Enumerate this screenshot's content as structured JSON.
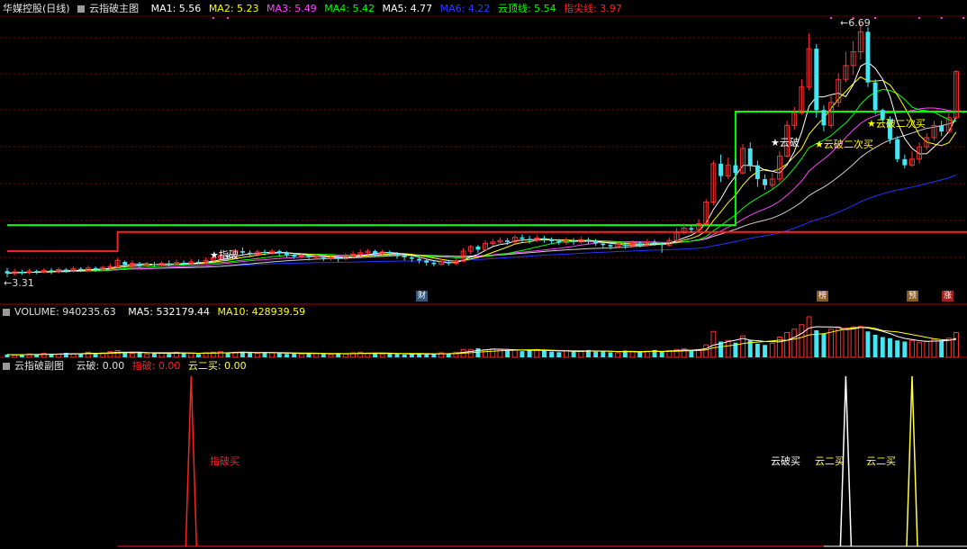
{
  "colors": {
    "ma1": "#ffffff",
    "ma2": "#ffff00",
    "ma3": "#ff44ff",
    "ma4": "#00ff00",
    "ma5": "#ffffff",
    "ma6": "#2233ff",
    "cloud": "#00ff00",
    "indicator": "#ff2020",
    "up": "#ff3030",
    "down": "#45e5f2",
    "grid": "#800000",
    "sub_red": "#ff2020",
    "sub_white": "#ffffff",
    "sub_yellow": "#ffff40"
  },
  "main_header": {
    "stock": "华媒控股(日线)",
    "indicator": "云指破主图",
    "ma1": "MA1: 5.56",
    "ma2": "MA2: 5.23",
    "ma3": "MA3: 5.49",
    "ma4": "MA4: 5.42",
    "ma5": "MA5: 4.77",
    "ma6": "MA6: 4.22",
    "cloud_line": "云顶线: 5.54",
    "indicator_line": "指尖线: 3.97"
  },
  "price_labels": {
    "high": "6.69",
    "low": "3.31"
  },
  "signals": {
    "zhipo": "指破",
    "yunpo": "云破",
    "yunpo_second": "云破二次买",
    "yunpo_second_2": "云破二次买"
  },
  "badges": {
    "cai": "财",
    "bang": "榜",
    "yu": "预",
    "zhang": "涨"
  },
  "volume_header": {
    "volume": "VOLUME: 940235.63",
    "ma5": "MA5: 532179.44",
    "ma10": "MA10: 428939.59"
  },
  "sub_header": {
    "name": "云指破副图",
    "yunpo": "云破: 0.00",
    "zhipo": "指破: 0.00",
    "yun_er": "云二买: 0.00"
  },
  "sub_labels": {
    "zhipo_buy": "指破买",
    "yunpo_buy": "云破买",
    "yun_er_buy_1": "云二买",
    "yun_er_buy_2": "云二买"
  },
  "chart_data": {
    "type": "candlestick",
    "title": "华媒控股(日线)",
    "price_range": [
      3.31,
      6.69
    ],
    "cloud_top_line": 5.54,
    "indicator_line": 3.97,
    "candles": [
      [
        3.46,
        3.43,
        3.5,
        3.38
      ],
      [
        3.43,
        3.45,
        3.49,
        3.4
      ],
      [
        3.45,
        3.44,
        3.48,
        3.41
      ],
      [
        3.44,
        3.46,
        3.49,
        3.42
      ],
      [
        3.46,
        3.45,
        3.48,
        3.42
      ],
      [
        3.45,
        3.47,
        3.5,
        3.43
      ],
      [
        3.47,
        3.45,
        3.5,
        3.42
      ],
      [
        3.45,
        3.48,
        3.51,
        3.43
      ],
      [
        3.48,
        3.46,
        3.5,
        3.44
      ],
      [
        3.46,
        3.49,
        3.52,
        3.44
      ],
      [
        3.49,
        3.47,
        3.51,
        3.45
      ],
      [
        3.47,
        3.5,
        3.53,
        3.45
      ],
      [
        3.5,
        3.48,
        3.52,
        3.45
      ],
      [
        3.48,
        3.51,
        3.53,
        3.46
      ],
      [
        3.51,
        3.52,
        3.56,
        3.48
      ],
      [
        3.52,
        3.6,
        3.63,
        3.5
      ],
      [
        3.58,
        3.54,
        3.6,
        3.5
      ],
      [
        3.54,
        3.56,
        3.6,
        3.5
      ],
      [
        3.56,
        3.53,
        3.58,
        3.5
      ],
      [
        3.53,
        3.55,
        3.58,
        3.5
      ],
      [
        3.55,
        3.54,
        3.58,
        3.51
      ],
      [
        3.54,
        3.56,
        3.59,
        3.52
      ],
      [
        3.56,
        3.55,
        3.6,
        3.52
      ],
      [
        3.55,
        3.57,
        3.61,
        3.53
      ],
      [
        3.57,
        3.56,
        3.6,
        3.53
      ],
      [
        3.56,
        3.58,
        3.62,
        3.54
      ],
      [
        3.58,
        3.57,
        3.61,
        3.55
      ],
      [
        3.57,
        3.6,
        3.64,
        3.55
      ],
      [
        3.6,
        3.63,
        3.67,
        3.58
      ],
      [
        3.63,
        3.66,
        3.7,
        3.6
      ],
      [
        3.66,
        3.64,
        3.69,
        3.6
      ],
      [
        3.64,
        3.73,
        3.75,
        3.62
      ],
      [
        3.72,
        3.7,
        3.77,
        3.66
      ],
      [
        3.7,
        3.68,
        3.73,
        3.64
      ],
      [
        3.68,
        3.71,
        3.74,
        3.65
      ],
      [
        3.71,
        3.7,
        3.74,
        3.66
      ],
      [
        3.7,
        3.72,
        3.75,
        3.67
      ],
      [
        3.72,
        3.7,
        3.74,
        3.66
      ],
      [
        3.7,
        3.67,
        3.72,
        3.64
      ],
      [
        3.67,
        3.65,
        3.69,
        3.62
      ],
      [
        3.65,
        3.66,
        3.69,
        3.62
      ],
      [
        3.66,
        3.64,
        3.68,
        3.6
      ],
      [
        3.64,
        3.65,
        3.68,
        3.61
      ],
      [
        3.65,
        3.63,
        3.67,
        3.59
      ],
      [
        3.63,
        3.64,
        3.67,
        3.6
      ],
      [
        3.64,
        3.62,
        3.66,
        3.58
      ],
      [
        3.62,
        3.65,
        3.69,
        3.6
      ],
      [
        3.65,
        3.68,
        3.72,
        3.63
      ],
      [
        3.68,
        3.7,
        3.74,
        3.65
      ],
      [
        3.7,
        3.72,
        3.75,
        3.67
      ],
      [
        3.72,
        3.69,
        3.74,
        3.65
      ],
      [
        3.69,
        3.71,
        3.74,
        3.66
      ],
      [
        3.71,
        3.69,
        3.73,
        3.65
      ],
      [
        3.69,
        3.66,
        3.71,
        3.62
      ],
      [
        3.66,
        3.64,
        3.68,
        3.6
      ],
      [
        3.64,
        3.62,
        3.66,
        3.58
      ],
      [
        3.62,
        3.6,
        3.64,
        3.56
      ],
      [
        3.6,
        3.57,
        3.62,
        3.53
      ],
      [
        3.57,
        3.55,
        3.6,
        3.52
      ],
      [
        3.55,
        3.58,
        3.62,
        3.53
      ],
      [
        3.58,
        3.56,
        3.61,
        3.53
      ],
      [
        3.56,
        3.59,
        3.63,
        3.54
      ],
      [
        3.59,
        3.72,
        3.76,
        3.58
      ],
      [
        3.72,
        3.78,
        3.8,
        3.68
      ],
      [
        3.78,
        3.74,
        3.8,
        3.7
      ],
      [
        3.74,
        3.82,
        3.86,
        3.72
      ],
      [
        3.82,
        3.84,
        3.88,
        3.79
      ],
      [
        3.84,
        3.86,
        3.9,
        3.8
      ],
      [
        3.86,
        3.84,
        3.89,
        3.8
      ],
      [
        3.84,
        3.9,
        3.93,
        3.82
      ],
      [
        3.9,
        3.88,
        3.94,
        3.84
      ],
      [
        3.88,
        3.86,
        3.92,
        3.82
      ],
      [
        3.86,
        3.89,
        3.93,
        3.84
      ],
      [
        3.89,
        3.87,
        3.92,
        3.83
      ],
      [
        3.87,
        3.85,
        3.9,
        3.81
      ],
      [
        3.85,
        3.83,
        3.88,
        3.8
      ],
      [
        3.83,
        3.86,
        3.9,
        3.8
      ],
      [
        3.86,
        3.84,
        3.89,
        3.8
      ],
      [
        3.84,
        3.87,
        3.91,
        3.82
      ],
      [
        3.87,
        3.85,
        3.9,
        3.81
      ],
      [
        3.85,
        3.82,
        3.88,
        3.79
      ],
      [
        3.82,
        3.8,
        3.85,
        3.76
      ],
      [
        3.8,
        3.78,
        3.83,
        3.74
      ],
      [
        3.78,
        3.81,
        3.85,
        3.76
      ],
      [
        3.81,
        3.79,
        3.84,
        3.75
      ],
      [
        3.79,
        3.82,
        3.86,
        3.77
      ],
      [
        3.82,
        3.8,
        3.85,
        3.77
      ],
      [
        3.8,
        3.84,
        3.88,
        3.78
      ],
      [
        3.84,
        3.82,
        3.87,
        3.79
      ],
      [
        3.82,
        3.8,
        3.84,
        3.7
      ],
      [
        3.8,
        3.86,
        3.9,
        3.78
      ],
      [
        3.86,
        3.96,
        4.02,
        3.84
      ],
      [
        3.96,
        4.02,
        4.08,
        3.94
      ],
      [
        4.02,
        4.0,
        4.06,
        3.96
      ],
      [
        4.0,
        4.08,
        4.14,
        3.98
      ],
      [
        4.08,
        4.36,
        4.4,
        4.06
      ],
      [
        4.36,
        4.86,
        4.9,
        4.32
      ],
      [
        4.86,
        4.7,
        4.98,
        4.62
      ],
      [
        4.7,
        4.84,
        4.94,
        4.66
      ],
      [
        4.84,
        4.74,
        4.92,
        4.64
      ],
      [
        4.74,
        5.06,
        5.12,
        4.72
      ],
      [
        5.06,
        4.84,
        5.14,
        4.76
      ],
      [
        4.84,
        4.66,
        4.9,
        4.56
      ],
      [
        4.66,
        4.58,
        4.72,
        4.52
      ],
      [
        4.58,
        4.66,
        4.74,
        4.54
      ],
      [
        4.66,
        4.96,
        5.02,
        4.62
      ],
      [
        4.96,
        5.36,
        5.42,
        4.94
      ],
      [
        5.36,
        5.52,
        5.6,
        5.3
      ],
      [
        5.52,
        5.86,
        5.96,
        5.5
      ],
      [
        5.86,
        6.36,
        6.56,
        5.82
      ],
      [
        6.36,
        5.56,
        6.42,
        5.46
      ],
      [
        5.56,
        5.36,
        5.62,
        5.28
      ],
      [
        5.36,
        5.66,
        5.74,
        5.32
      ],
      [
        5.66,
        5.96,
        6.04,
        5.6
      ],
      [
        5.96,
        6.14,
        6.32,
        5.92
      ],
      [
        6.14,
        6.32,
        6.46,
        6.02
      ],
      [
        6.32,
        6.58,
        6.69,
        6.22
      ],
      [
        6.58,
        5.92,
        6.64,
        5.86
      ],
      [
        5.92,
        5.56,
        5.96,
        5.5
      ],
      [
        5.56,
        5.44,
        5.58,
        5.38
      ],
      [
        5.44,
        5.18,
        5.48,
        5.12
      ],
      [
        5.18,
        4.92,
        5.22,
        4.88
      ],
      [
        4.92,
        4.84,
        4.98,
        4.8
      ],
      [
        4.84,
        4.92,
        5.02,
        4.82
      ],
      [
        4.92,
        5.08,
        5.14,
        4.86
      ],
      [
        5.08,
        5.2,
        5.26,
        5.04
      ],
      [
        5.2,
        5.36,
        5.42,
        5.16
      ],
      [
        5.36,
        5.28,
        5.42,
        5.22
      ],
      [
        5.28,
        5.46,
        5.56,
        5.26
      ],
      [
        5.46,
        6.06,
        6.08,
        5.44
      ]
    ],
    "volume": [
      5,
      4,
      5,
      6,
      5,
      7,
      5,
      6,
      8,
      6,
      7,
      9,
      6,
      8,
      10,
      12,
      9,
      7,
      8,
      6,
      7,
      8,
      6,
      9,
      8,
      7,
      6,
      8,
      9,
      10,
      8,
      9,
      10,
      8,
      7,
      9,
      8,
      7,
      6,
      7,
      6,
      8,
      7,
      6,
      5,
      7,
      6,
      8,
      9,
      7,
      8,
      6,
      7,
      6,
      5,
      6,
      7,
      5,
      6,
      8,
      7,
      9,
      14,
      14,
      16,
      13,
      15,
      14,
      12,
      13,
      11,
      12,
      14,
      12,
      10,
      9,
      12,
      10,
      11,
      13,
      10,
      11,
      9,
      8,
      12,
      10,
      9,
      11,
      13,
      10,
      12,
      14,
      15,
      12,
      14,
      22,
      46,
      28,
      30,
      26,
      38,
      30,
      24,
      22,
      25,
      36,
      44,
      50,
      58,
      72,
      48,
      42,
      50,
      54,
      52,
      54,
      55,
      46,
      40,
      36,
      34,
      30,
      28,
      30,
      26,
      28,
      32,
      30,
      34,
      44
    ],
    "sub_signals": [
      {
        "name": "指破买",
        "x_index": 25
      },
      {
        "name": "云破买",
        "x_index": 114
      },
      {
        "name": "云二买",
        "x_index": 123
      },
      {
        "name": "云二买",
        "x_index": 134
      }
    ]
  }
}
